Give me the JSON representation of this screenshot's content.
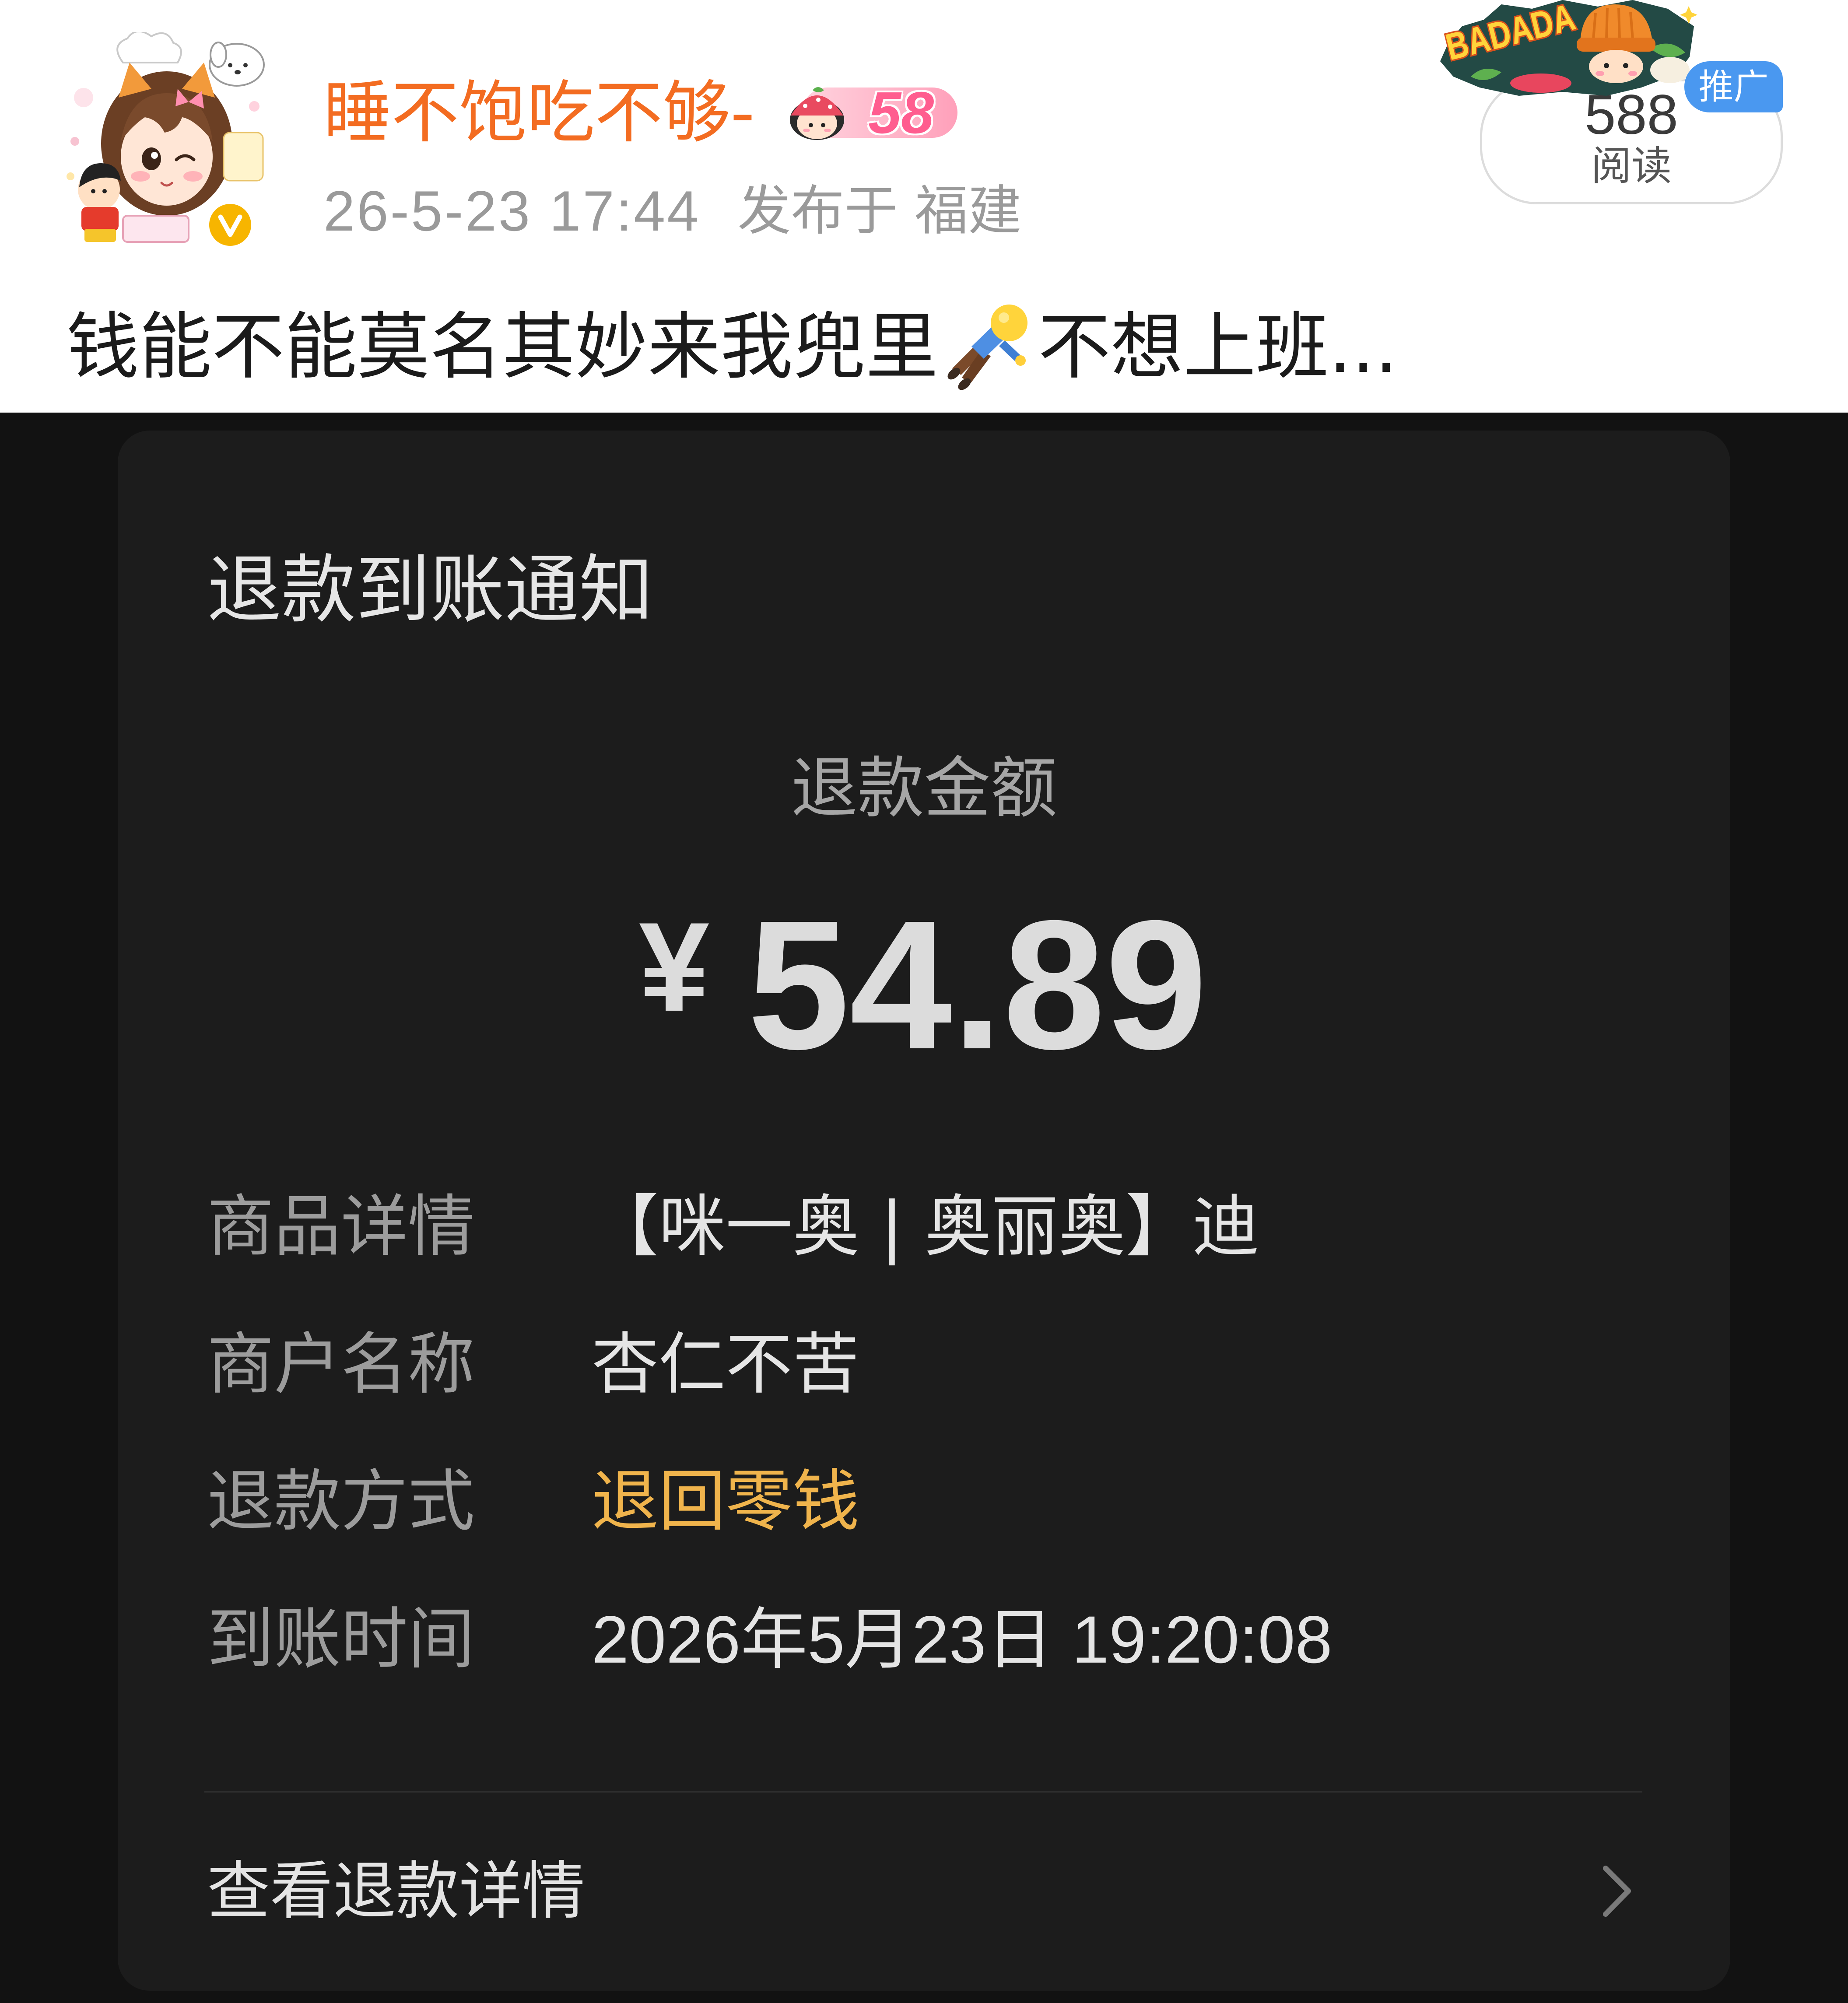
{
  "post": {
    "author": {
      "name": "睡不饱吃不够-",
      "level": "58",
      "verified": true
    },
    "meta": {
      "time": "26-5-23 17:44",
      "location": "发布于 福建"
    },
    "reads": {
      "count": "588",
      "label": "阅读",
      "promo_label": "推广"
    },
    "sticker": {
      "text": "BADADA"
    },
    "content": {
      "text_before": "钱能不能莫名其妙来我兜里",
      "text_after": "不想上班..."
    }
  },
  "notice": {
    "title": "退款到账通知",
    "amount_label": "退款金额",
    "currency": "¥",
    "amount": "54.89",
    "rows": [
      {
        "label": "商品详情",
        "value": "【咪一奥 | 奥丽奥】迪"
      },
      {
        "label": "商户名称",
        "value": "杏仁不苦"
      },
      {
        "label": "退款方式",
        "value": "退回零钱",
        "highlight": true
      },
      {
        "label": "到账时间",
        "value": "2026年5月23日 19:20:08"
      }
    ],
    "details_link": "查看退款详情"
  },
  "colors": {
    "username": "#f36c21",
    "refund_method": "#f0b44c",
    "promo_tag": "#4a98f0",
    "verified_badge": "#f7b500",
    "level_badge": "#ff5d8f",
    "card_bg": "#1c1c1c",
    "page_bg": "#121212"
  },
  "icons": {
    "avatar": "avatar-image",
    "verified": "verified-badge-icon",
    "level": "level-badge-icon",
    "sticker": "badada-sticker",
    "emoji": "person-falling-emoji",
    "chevron": "chevron-right-icon"
  }
}
